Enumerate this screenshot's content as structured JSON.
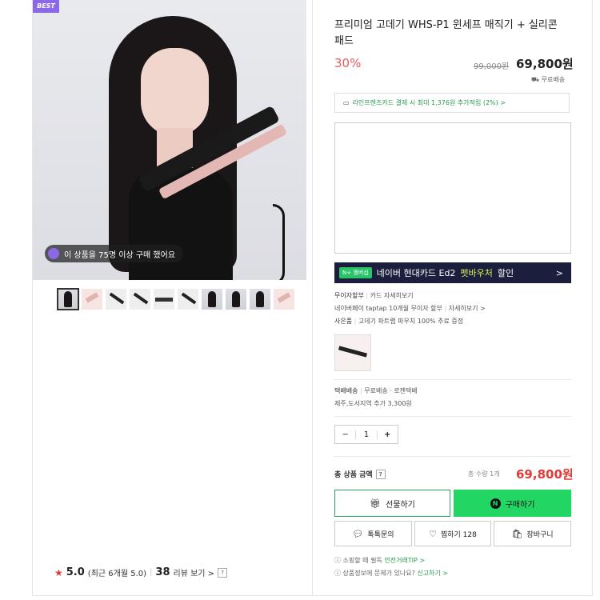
{
  "left": {
    "best_label": "BEST",
    "badge_text": "이 상품을 75명 이상 구매 했어요",
    "rating": {
      "score": "5.0",
      "recent": "(최근 6개월 5.0)",
      "reviews_count": "38",
      "reviews_label": "리뷰 보기 >",
      "help": "?"
    }
  },
  "product": {
    "title": "프리미엄 고데기 WHS-P1 윈세프 매직기 + 실리콘패드",
    "discount": "30%",
    "original_price": "99,000원",
    "price": "69,800원",
    "shipping_short": "무료배송",
    "card_benefit": "라인프렌즈카드 결제 시 최대 1,376원 추가적립 (2%) >"
  },
  "banner": {
    "tag": "N+ 멤버십",
    "text_a": "네이버 현대카드 Ed2",
    "text_b": "펫바우처",
    "text_c": "할인",
    "arrow": ">"
  },
  "info": {
    "row1_label": "무이자할부",
    "row1_value": "카드 자세히보기",
    "row2": "네이버페이 taptap 10개월 무이자 할부",
    "row2_link": "자세히보기 >",
    "row3_label": "사은품",
    "row3_value": "고데기 파트랩 파우치 100% 추료 증정",
    "delivery_label": "택배배송",
    "delivery_value": "무료배송 · 로젠택배",
    "delivery_extra": "제주,도서지역 추가 3,300원"
  },
  "quantity": {
    "minus": "−",
    "value": "1",
    "plus": "+"
  },
  "total": {
    "label": "총 상품 금액",
    "help": "?",
    "qty_text": "총 수량 1개",
    "price": "69,800원"
  },
  "buttons": {
    "gift": "선물하기",
    "buy": "구매하기",
    "npay": "N",
    "talk": "톡톡문의",
    "wish": "찜하기 128",
    "cart": "장바구니"
  },
  "footer": {
    "line1_a": "소핑할 때 필독",
    "line1_b": "안전거래TIP >",
    "line2_a": "상품정보에 문제가 있나요?",
    "line2_b": "신고하기 >"
  },
  "colors": {
    "accent_green": "#22d663",
    "discount_red": "#e85b5b",
    "banner_bg": "#1b1f3d"
  },
  "icons": [
    "card-icon",
    "gift-icon",
    "chat-icon",
    "heart-icon",
    "cart-icon",
    "info-icon",
    "star-icon"
  ]
}
